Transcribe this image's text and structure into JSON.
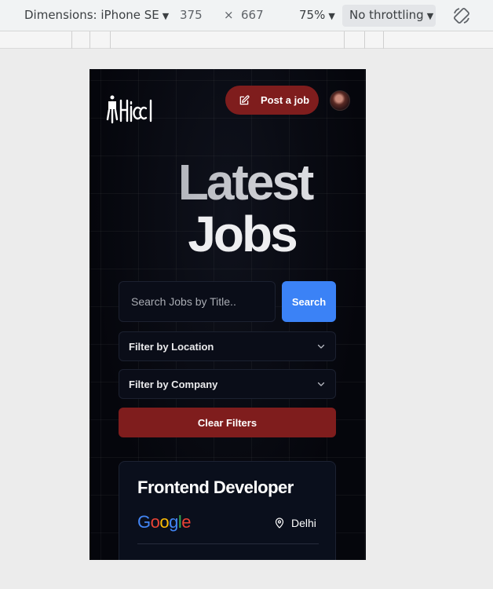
{
  "devtools": {
    "dimensions_label": "Dimensions: iPhone SE",
    "width": "375",
    "times": "×",
    "height": "667",
    "zoom": "75%",
    "throttling": "No throttling",
    "caret": "▼"
  },
  "header": {
    "post_job_label": "Post a job"
  },
  "hero": {
    "line1": "Latest",
    "line2": "Jobs"
  },
  "search": {
    "placeholder": "Search Jobs by Title..",
    "button_label": "Search"
  },
  "filters": {
    "location_label": "Filter by Location",
    "company_label": "Filter by Company",
    "clear_label": "Clear Filters"
  },
  "job_card": {
    "title": "Frontend Developer",
    "company_letters": [
      "G",
      "o",
      "o",
      "g",
      "l",
      "e"
    ],
    "location": "Delhi"
  },
  "colors": {
    "accent_red": "#7f1d1d",
    "accent_blue": "#3b82f6",
    "google_blue": "#4285F4",
    "google_red": "#EA4335",
    "google_yellow": "#FBBC05",
    "google_green": "#34A853"
  },
  "icons": [
    "rotate-icon",
    "logo-icon",
    "edit-icon",
    "chevron-down-icon",
    "map-pin-icon"
  ]
}
